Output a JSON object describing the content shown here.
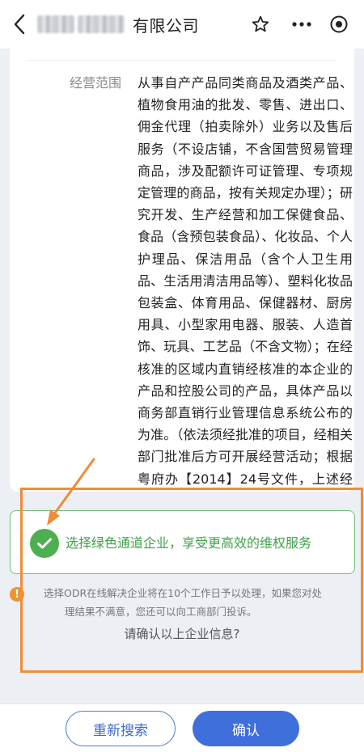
{
  "navbar": {
    "title_suffix": "有限公司",
    "icons": {
      "back": "chevron-left-icon",
      "favorite": "star-icon",
      "more": "more-dots-icon",
      "close": "target-close-icon"
    }
  },
  "card": {
    "business_scope_label": "经营范围",
    "business_scope_value": "从事自产产品同类商品及酒类产品、植物食用油的批发、零售、进出口、佣金代理（拍卖除外）业务以及售后服务（不设店铺，不含国营贸易管理商品，涉及配额许可证管理、专项规定管理的商品，按有关规定办理）；研究开发、生产经营和加工保健食品、食品（含预包装食品）、化妆品、个人护理品、保洁用品（含个人卫生用品、生活用清洁用品等）、塑料化妆品包装盒、体育用品、保健器材、厨房用具、小型家用电器、服装、人造首饰、玩具、工艺品（不含文物）；在经核准的区域内直销经核准的本企业的产品和控股公司的产品，具体产品以商务部直销行业管理信息系统公布的为准。（依法须经批准的项目，经相关部门批准后方可开展经营活动；根据粤府办【2014】24号文件，上述经营范围涉及：食品流通等事项。）(依法须经批准的项目，经相关部门批准后方可开展经营活动)"
  },
  "green_channel": {
    "icon": "check-circle-icon",
    "text": "选择绿色通道企业，享受更高效的维权服务"
  },
  "notice": {
    "icon": "warning-icon",
    "line1": "选择ODR在线解决企业将在10个工作日予以处理，如果您对处",
    "line2": "理结果不满意，您还可以向工商部门投诉。",
    "question": "请确认以上企业信息?"
  },
  "buttons": {
    "research": "重新搜索",
    "confirm": "确认"
  },
  "colors": {
    "accent_blue": "#3f6fdb",
    "green": "#4caf50",
    "annotation_orange": "#f08c3a",
    "warning_orange": "#f0932b"
  }
}
